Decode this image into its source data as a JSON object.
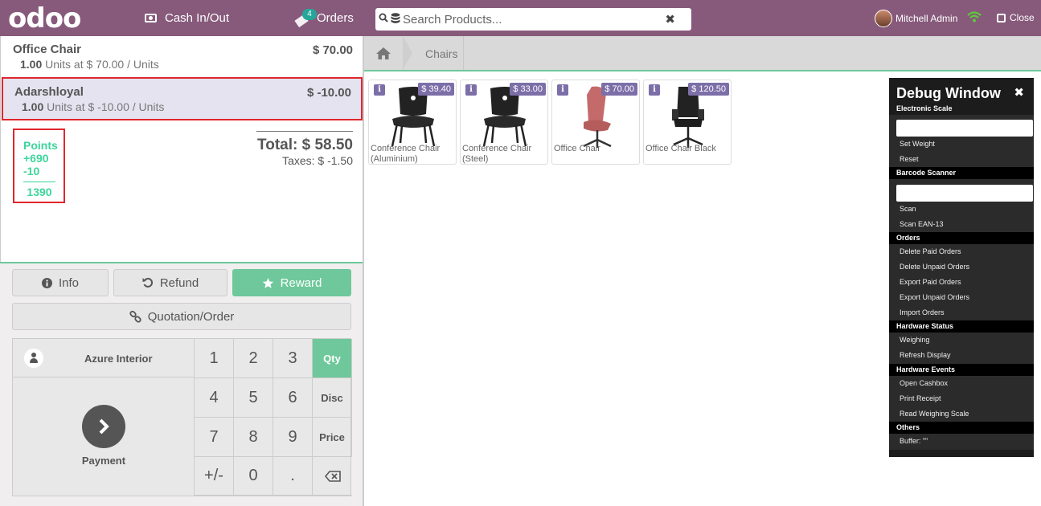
{
  "header": {
    "logo": "odoo",
    "cash_label": "Cash In/Out",
    "orders_label": "Orders",
    "orders_count": "4",
    "search_placeholder": "Search Products...",
    "search_clear": "✖",
    "user_name": "Mitchell Admin",
    "close_label": "Close",
    "bg_color": "#875a7b"
  },
  "order": {
    "lines": [
      {
        "name": "Office Chair",
        "price": "$ 70.00",
        "qty": "1.00",
        "detail": "Units at $ 70.00 / Units"
      },
      {
        "name": "Adarshloyal",
        "price": "$ -10.00",
        "qty": "1.00",
        "detail": "Units at $ -10.00 / Units"
      }
    ],
    "points": {
      "label": "Points",
      "won": "+690",
      "spent": "-10",
      "total": "1390"
    },
    "total": "Total: $ 58.50",
    "taxes": "Taxes: $ -1.50"
  },
  "controls": {
    "info": "Info",
    "refund": "Refund",
    "reward": "Reward",
    "quotation": "Quotation/Order",
    "customer": "Azure Interior",
    "payment": "Payment",
    "keys": [
      "1",
      "2",
      "3",
      "4",
      "5",
      "6",
      "7",
      "8",
      "9",
      "+/-",
      "0",
      "."
    ],
    "modes": [
      "Qty",
      "Disc",
      "Price"
    ],
    "accent": "#6ec89b"
  },
  "breadcrumb": {
    "category": "Chairs"
  },
  "products": [
    {
      "name": "Conference Chair (Aluminium)",
      "price": "$ 39.40"
    },
    {
      "name": "Conference Chair (Steel)",
      "price": "$ 33.00"
    },
    {
      "name": "Office Chair",
      "price": "$ 70.00"
    },
    {
      "name": "Office Chair Black",
      "price": "$ 120.50"
    }
  ],
  "debug": {
    "title": "Debug Window",
    "close": "✖",
    "sections": {
      "scale": "Electronic Scale",
      "barcode": "Barcode Scanner",
      "orders": "Orders",
      "hw_status": "Hardware Status",
      "hw_events": "Hardware Events",
      "others": "Others"
    },
    "scale_items": [
      "Set Weight",
      "Reset"
    ],
    "barcode_items": [
      "Scan",
      "Scan EAN-13"
    ],
    "orders_items": [
      "Delete Paid Orders",
      "Delete Unpaid Orders",
      "Export Paid Orders",
      "Export Unpaid Orders",
      "Import Orders"
    ],
    "status_items": [
      "Weighing",
      "Refresh Display"
    ],
    "event_items": [
      "Open Cashbox",
      "Print Receipt",
      "Read Weighing Scale"
    ],
    "buffer": "Buffer: \"\""
  }
}
